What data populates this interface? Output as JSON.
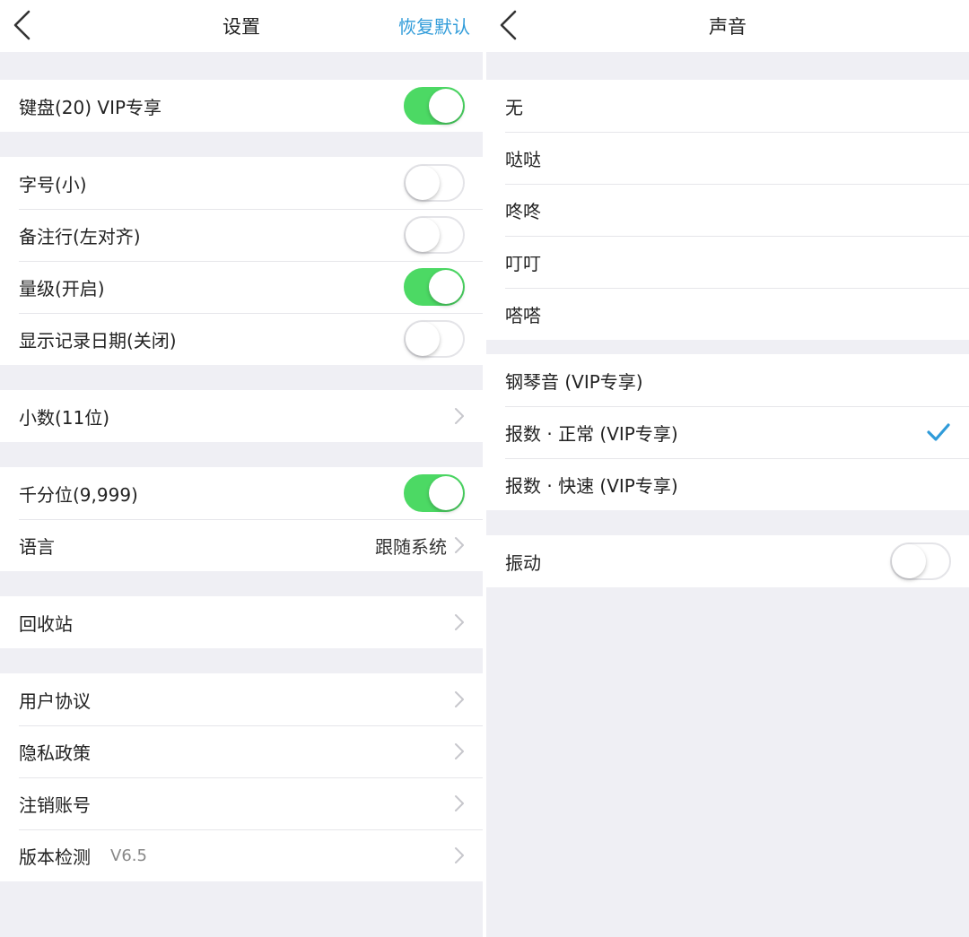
{
  "colors": {
    "accent_blue": "#2f9bd9",
    "toggle_on_green": "#4cd964",
    "background_gray": "#efeff4"
  },
  "left": {
    "nav": {
      "back_icon": "chevron-left-icon",
      "title": "设置",
      "action": "恢复默认"
    },
    "rows": {
      "keyboard": {
        "label": "键盘(20) VIP专享",
        "on": true
      },
      "font_size": {
        "label": "字号(小)",
        "on": false
      },
      "note_row": {
        "label": "备注行(左对齐)",
        "on": false
      },
      "magnitude": {
        "label": "量级(开启)",
        "on": true
      },
      "show_date": {
        "label": "显示记录日期(关闭)",
        "on": false
      },
      "decimal": {
        "label": "小数(11位)"
      },
      "thousands": {
        "label": "千分位(9,999)",
        "on": true
      },
      "language": {
        "label": "语言",
        "value": "跟随系统"
      },
      "recycle": {
        "label": "回收站"
      },
      "user_agreement": {
        "label": "用户协议"
      },
      "privacy": {
        "label": "隐私政策"
      },
      "delete_account": {
        "label": "注销账号"
      },
      "version": {
        "label": "版本检测",
        "value": "V6.5"
      }
    }
  },
  "right": {
    "nav": {
      "back_icon": "chevron-left-icon",
      "title": "声音"
    },
    "sounds": {
      "none": "无",
      "dada": "哒哒",
      "dongdong": "咚咚",
      "dingding": "叮叮",
      "dada2": "嗒嗒",
      "piano": "钢琴音 (VIP专享)",
      "count_normal": "报数 · 正常 (VIP专享)",
      "count_fast": "报数 · 快速 (VIP专享)"
    },
    "selected_sound": "报数 · 正常 (VIP专享)",
    "vibration": {
      "label": "振动",
      "on": false
    }
  }
}
